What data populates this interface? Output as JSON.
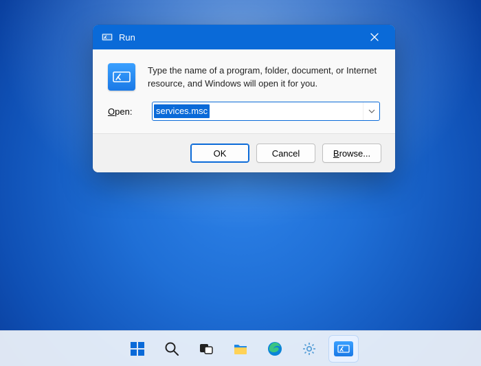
{
  "dialog": {
    "title": "Run",
    "description": "Type the name of a program, folder, document, or Internet resource, and Windows will open it for you.",
    "open_label_pre": "O",
    "open_label_post": "pen:",
    "input_value": "services.msc",
    "buttons": {
      "ok": "OK",
      "cancel": "Cancel",
      "browse_pre": "B",
      "browse_post": "rowse..."
    }
  },
  "taskbar": {
    "items": [
      "start",
      "search",
      "task-view",
      "file-explorer",
      "edge",
      "settings",
      "run"
    ]
  }
}
